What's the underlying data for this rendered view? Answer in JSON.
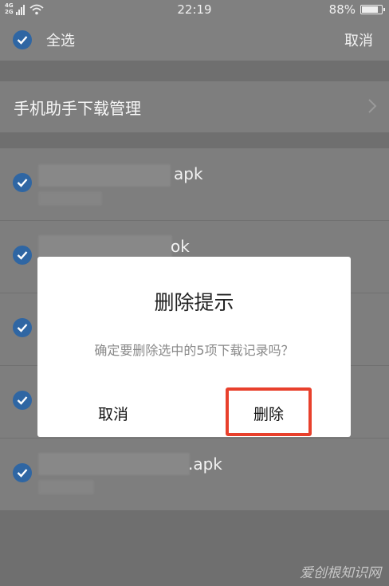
{
  "status_bar": {
    "network_top": "4G",
    "network_bottom": "2G",
    "time": "22:19",
    "battery": "88%",
    "battery_level": 0.88
  },
  "header": {
    "select_all_label": "全选",
    "cancel_label": "取消",
    "select_all_checked": true
  },
  "section": {
    "title": "手机助手下载管理"
  },
  "list": {
    "items": [
      {
        "visible_suffix": "apk",
        "checked": true
      },
      {
        "visible_suffix": "ok",
        "checked": true
      },
      {
        "visible_suffix": "",
        "checked": true
      },
      {
        "visible_suffix": "",
        "checked": true
      },
      {
        "visible_suffix": ".apk",
        "checked": true
      }
    ]
  },
  "dialog": {
    "title": "删除提示",
    "message": "确定要删除选中的5项下载记录吗？",
    "cancel_label": "取消",
    "delete_label": "删除"
  },
  "colors": {
    "accent_check": "#2f66a3",
    "highlight": "#e8402c"
  },
  "watermark": "爱创根知识网"
}
